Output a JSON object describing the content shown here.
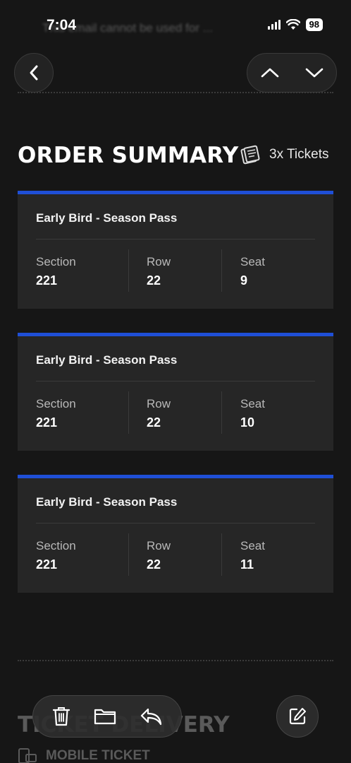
{
  "status": {
    "time": "7:04",
    "ghost_text": "This email cannot be used for ...",
    "battery": "98"
  },
  "header": {
    "title": "ORDER SUMMARY",
    "ticket_count": "3x Tickets"
  },
  "tickets": [
    {
      "name": "Early Bird - Season Pass",
      "section_label": "Section",
      "section": "221",
      "row_label": "Row",
      "row": "22",
      "seat_label": "Seat",
      "seat": "9"
    },
    {
      "name": "Early Bird - Season Pass",
      "section_label": "Section",
      "section": "221",
      "row_label": "Row",
      "row": "22",
      "seat_label": "Seat",
      "seat": "10"
    },
    {
      "name": "Early Bird - Season Pass",
      "section_label": "Section",
      "section": "221",
      "row_label": "Row",
      "row": "22",
      "seat_label": "Seat",
      "seat": "11"
    }
  ],
  "delivery": {
    "title": "TICKET DELIVERY",
    "method": "MOBILE TICKET"
  },
  "icons": {
    "back": "chevron-left-icon",
    "up": "chevron-up-icon",
    "down": "chevron-down-icon",
    "tickets": "ticket-icon",
    "trash": "trash-icon",
    "folder": "folder-icon",
    "reply": "reply-icon",
    "compose": "compose-icon"
  },
  "colors": {
    "background": "#161616",
    "card": "#262626",
    "accent": "#1f4fd6"
  }
}
